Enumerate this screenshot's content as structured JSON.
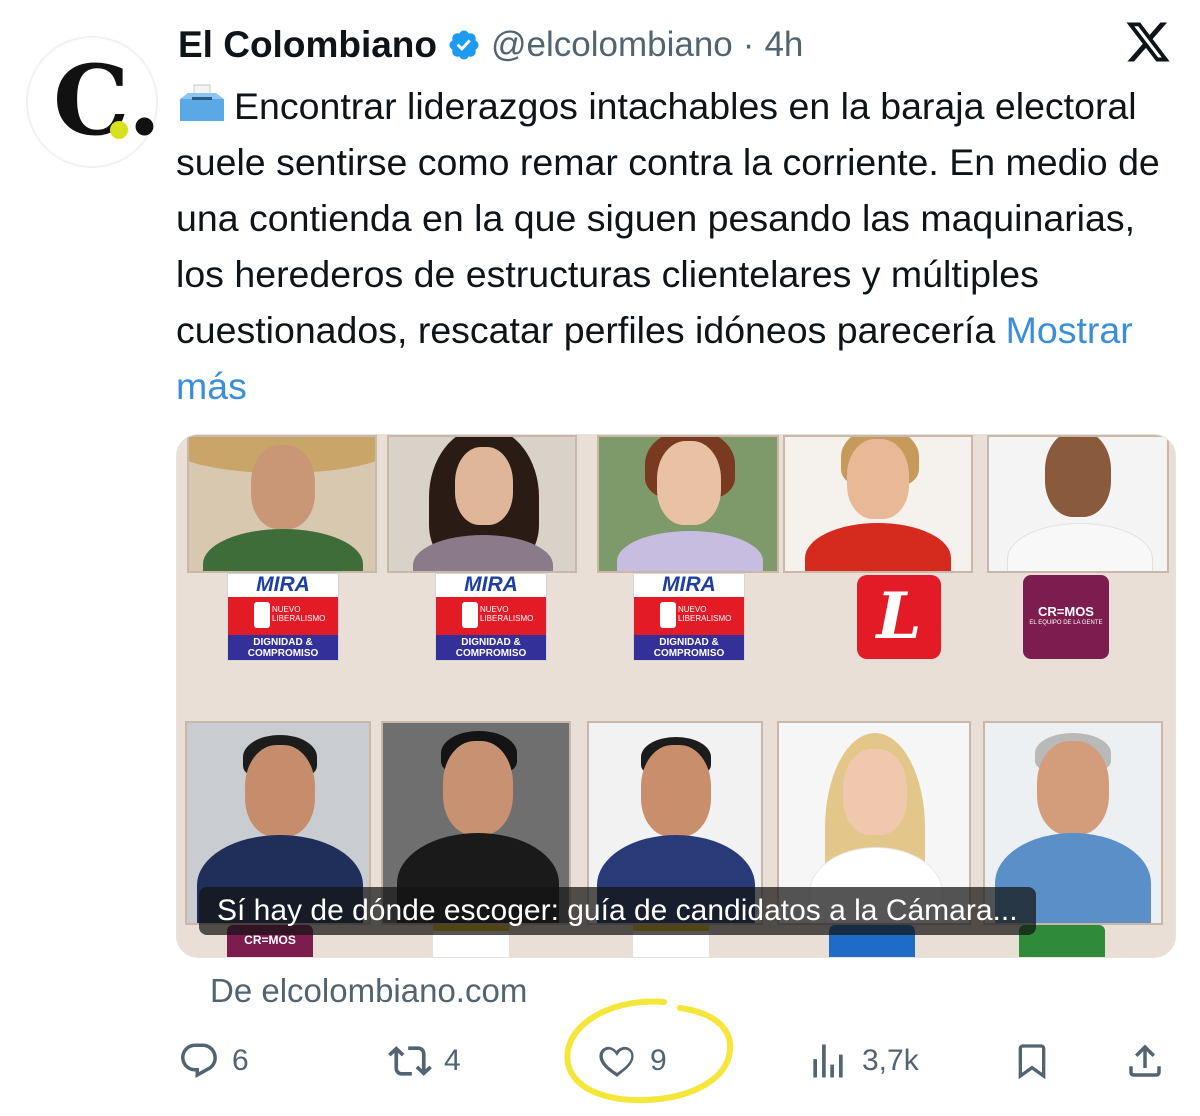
{
  "author": {
    "avatar_letter": "C.",
    "name": "El Colombiano",
    "handle": "@elcolombiano",
    "separator": "·",
    "time": "4h"
  },
  "tweet": {
    "text": "Encontrar liderazgos intachables en la baraja electoral suele sentirse como remar contra la corriente. En medio de una contienda en la que siguen pesando las maquinarias, los herederos de estructuras clientelares y múltiples cuestionados, rescatar perfiles idóneos parecería",
    "show_more": "Mostrar más"
  },
  "card": {
    "headline": "Sí hay de dónde escoger: guía de candidatos a la Cámara...",
    "logos": {
      "mira_top": "MIRA",
      "mira_mid": "NUEVO LIBERALISMO",
      "mira_bottom": "DIGNIDAD & COMPROMISO",
      "liberal": "L",
      "creemos": "CR=MOS",
      "creemos_sub": "EL EQUIPO DE LA GENTE",
      "creemos_bottom": "CR=MOS"
    },
    "source": "De elcolombiano.com"
  },
  "actions": {
    "replies": "6",
    "reposts": "4",
    "likes": "9",
    "views": "3,7k"
  },
  "colors": {
    "link": "#3b8fd8",
    "verified": "#1d9bf0",
    "highlight": "#f5e63a",
    "card_bg": "#e9dfd6"
  },
  "icons": [
    "verified-badge-icon",
    "x-logo-icon",
    "ballot-box-icon",
    "reply-icon",
    "repost-icon",
    "like-icon",
    "views-icon",
    "bookmark-icon",
    "share-icon"
  ]
}
